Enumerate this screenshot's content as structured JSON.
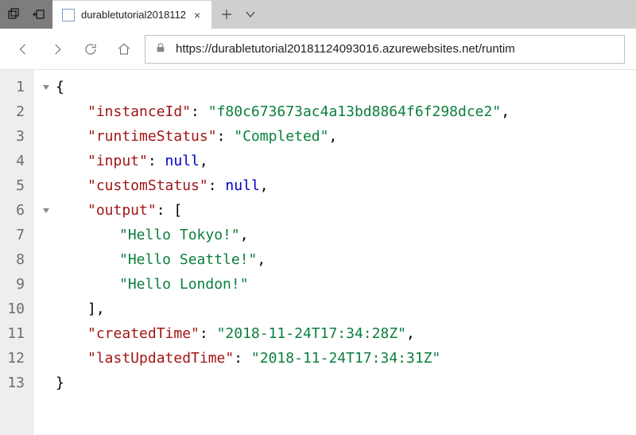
{
  "tab": {
    "title": "durabletutorial2018112",
    "close_glyph": "×"
  },
  "url": {
    "scheme": "https",
    "rest": "://durabletutorial20181124093016.azurewebsites.net/runtim"
  },
  "json_body": {
    "instanceId": "f80c673673ac4a13bd8864f6f298dce2",
    "runtimeStatus": "Completed",
    "input": null,
    "customStatus": null,
    "output": [
      "Hello Tokyo!",
      "Hello Seattle!",
      "Hello London!"
    ],
    "createdTime": "2018-11-24T17:34:28Z",
    "lastUpdatedTime": "2018-11-24T17:34:31Z"
  },
  "line_count": 13
}
